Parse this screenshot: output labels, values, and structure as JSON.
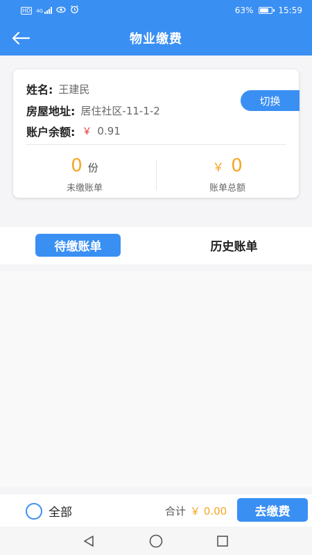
{
  "status_bar": {
    "network_label": "HD",
    "signal_label": "4G",
    "battery_percent": "63%",
    "battery_level": 0.63,
    "time": "15:59",
    "icons": [
      "hd-icon",
      "signal-icon",
      "eye-icon",
      "alarm-icon",
      "battery-icon"
    ]
  },
  "header": {
    "title": "物业缴费",
    "back_icon": "arrow-left-icon"
  },
  "info_card": {
    "name_label": "姓名:",
    "name_value": "王建民",
    "address_label": "房屋地址:",
    "address_value": "居住社区-11-1-2",
    "balance_label": "账户余额:",
    "balance_currency": "￥",
    "balance_value": "0.91",
    "switch_label": "切换",
    "unpaid_count": "0",
    "unpaid_unit": "份",
    "unpaid_label": "未缴账单",
    "total_currency": "￥",
    "total_amount": "0",
    "total_label": "账单总额"
  },
  "tabs": [
    {
      "label": "待缴账单",
      "active": true
    },
    {
      "label": "历史账单",
      "active": false
    }
  ],
  "footer": {
    "select_all_label": "全部",
    "total_label": "合计",
    "total_amount": "￥ 0.00",
    "pay_button": "去缴费"
  },
  "system_nav": {
    "icons": [
      "back-triangle-icon",
      "home-circle-icon",
      "recents-square-icon"
    ]
  },
  "colors": {
    "primary": "#3a8ff3",
    "accent": "#f5a623",
    "balance_yen": "#e23b3b"
  }
}
